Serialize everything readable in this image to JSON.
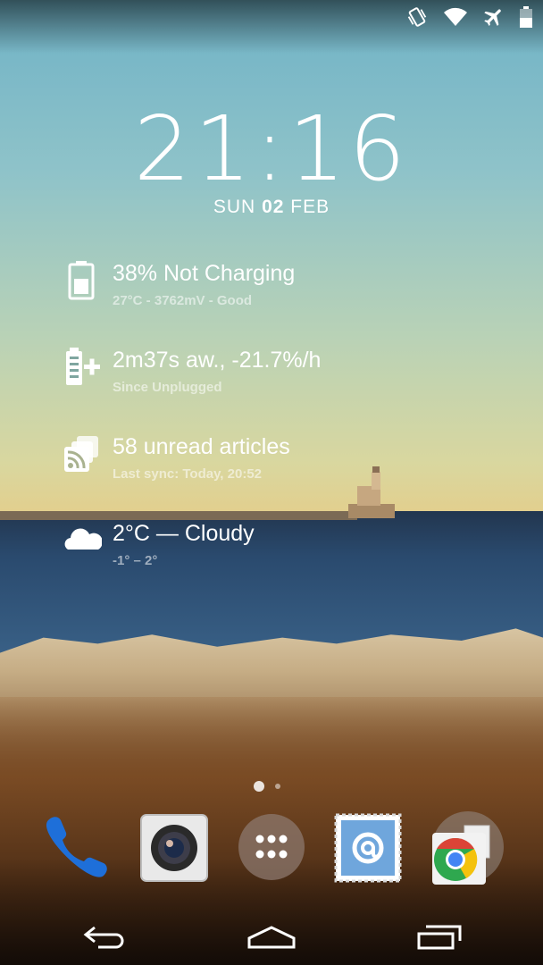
{
  "status_bar": {
    "icons": [
      "vibrate-icon",
      "wifi-icon",
      "airplane-mode-icon",
      "battery-icon"
    ]
  },
  "lockscreen": {
    "time": "21:16",
    "date": {
      "weekday": "SUN",
      "day": "02",
      "month": "FEB"
    }
  },
  "widgets": {
    "battery": {
      "title": "38% Not Charging",
      "subtitle": "27°C - 3762mV - Good",
      "icon": "battery-status-icon"
    },
    "usage": {
      "title": "2m37s aw., -21.7%/h",
      "subtitle": "Since Unplugged",
      "icon": "battery-usage-icon"
    },
    "rss": {
      "title": "58 unread articles",
      "subtitle": "Last sync:  Today, 20:52",
      "icon": "rss-icon"
    },
    "weather": {
      "title": "2°C — Cloudy",
      "subtitle": "-1° – 2°",
      "icon": "cloud-icon"
    }
  },
  "home_pages": {
    "current": 1,
    "total": 2
  },
  "dock": {
    "apps": [
      {
        "name": "Phone",
        "icon": "phone-icon"
      },
      {
        "name": "Camera",
        "icon": "camera-icon"
      },
      {
        "name": "Apps",
        "icon": "app-drawer-icon"
      },
      {
        "name": "Email",
        "icon": "email-icon"
      },
      {
        "name": "Chrome",
        "icon": "chrome-icon"
      }
    ]
  },
  "nav": {
    "back": "back-icon",
    "home": "home-icon",
    "recents": "recents-icon"
  },
  "colors": {
    "text": "#ffffff",
    "sea": "#2a4a6e",
    "sky_top": "#6fb2c6"
  }
}
